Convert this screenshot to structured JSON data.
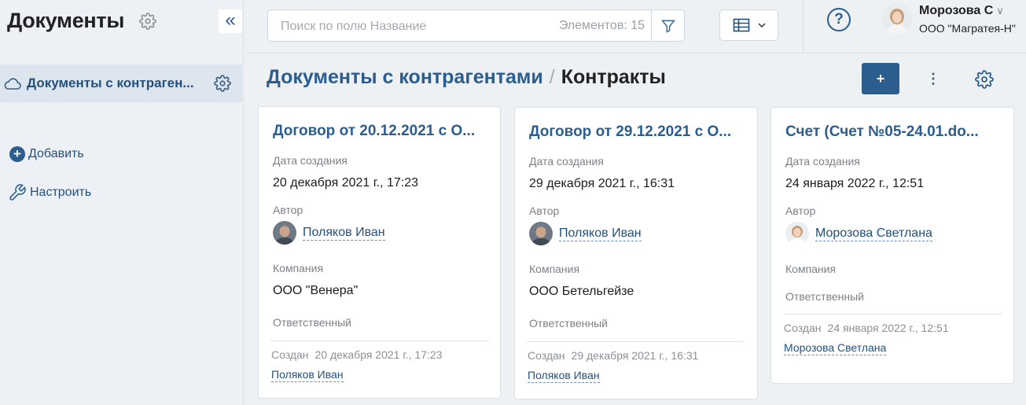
{
  "sidebar": {
    "title": "Документы",
    "collapse_glyph": "«",
    "items": [
      {
        "label": "Документы с контраген...",
        "icon": "cloud-icon"
      }
    ],
    "add_label": "Добавить",
    "setup_label": "Настроить"
  },
  "topbar": {
    "search_placeholder": "Поиск по полю Название",
    "count_label": "Элементов: 15",
    "help_glyph": "?",
    "user": {
      "name": "Морозова С",
      "company": "ООО \"Магратея-Н\""
    }
  },
  "header": {
    "breadcrumb_parent": "Документы с контрагентами",
    "breadcrumb_sep": "/",
    "breadcrumb_current": "Контракты",
    "add_glyph": "+",
    "more_glyph": "⋮"
  },
  "labels": {
    "created_date": "Дата создания",
    "author": "Автор",
    "company": "Компания",
    "responsible": "Ответственный",
    "created": "Создан"
  },
  "cards": [
    {
      "title": "Договор от 20.12.2021 с О...",
      "date": "20 декабря 2021 г., 17:23",
      "author": "Поляков Иван",
      "company": "ООО \"Венера\"",
      "created_at": "20 декабря 2021 г., 17:23",
      "created_by": "Поляков Иван"
    },
    {
      "title": "Договор от 29.12.2021 с О...",
      "date": "29 декабря 2021 г., 16:31",
      "author": "Поляков Иван",
      "company": "ООО Бетельгейзе",
      "created_at": "29 декабря 2021 г., 16:31",
      "created_by": "Поляков Иван"
    },
    {
      "title": "Счет (Счет №05-24.01.do...",
      "date": "24 января 2022 г., 12:51",
      "author": "Морозова Светлана",
      "company": "",
      "created_at": "24 января 2022 г., 12:51",
      "created_by": "Морозова Светлана"
    }
  ],
  "colors": {
    "accent": "#2b5e8e",
    "link": "#24507c",
    "background": "#eef1f4",
    "sidebar_active": "#dde6ee"
  }
}
